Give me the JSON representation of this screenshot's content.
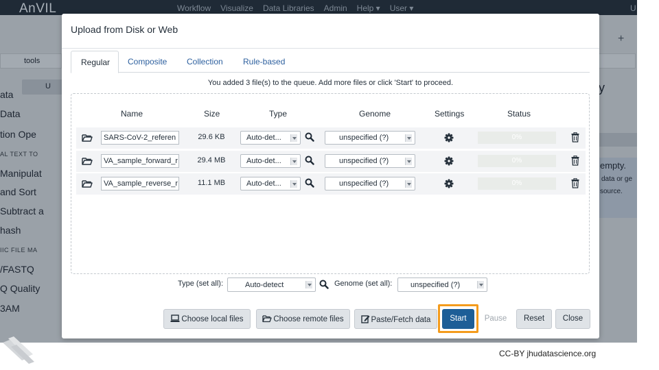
{
  "app": {
    "brand": "AnVIL",
    "nav": [
      "Workflow",
      "Visualize",
      "Data Libraries",
      "Admin",
      "Help ▾",
      "User ▾"
    ],
    "user_initial": "U",
    "right_panel": {
      "plus": "+",
      "partial_title": "y",
      "empty_text": "empty.",
      "line1": "data or ge",
      "line2": "source."
    },
    "left_panel": {
      "search": "tools",
      "upload": "U",
      "items": [
        {
          "kind": "tool",
          "label": "ata"
        },
        {
          "kind": "tool",
          "label": "Data"
        },
        {
          "kind": "tool",
          "label": "tion Ope"
        },
        {
          "kind": "section",
          "label": "AL TEXT TO"
        },
        {
          "kind": "tool",
          "label": "Manipulat"
        },
        {
          "kind": "tool",
          "label": "and Sort"
        },
        {
          "kind": "tool",
          "label": "Subtract a"
        },
        {
          "kind": "tool",
          "label": "hash"
        },
        {
          "kind": "section",
          "label": "IIC FILE MA"
        },
        {
          "kind": "tool",
          "label": "/FASTQ"
        },
        {
          "kind": "tool",
          "label": "Q Quality"
        },
        {
          "kind": "tool",
          "label": "3AM"
        }
      ]
    }
  },
  "modal": {
    "title": "Upload from Disk or Web",
    "tabs": [
      "Regular",
      "Composite",
      "Collection",
      "Rule-based"
    ],
    "active_tab": "Regular",
    "queue_message": "You added 3 file(s) to the queue. Add more files or click 'Start' to proceed.",
    "columns": [
      "Name",
      "Size",
      "Type",
      "Genome",
      "Settings",
      "Status"
    ],
    "rows": [
      {
        "name": "SARS-CoV-2_referen",
        "size": "29.6 KB",
        "type": "Auto-det...",
        "genome": "unspecified (?)",
        "status": "0%",
        "progress": 0
      },
      {
        "name": "VA_sample_forward_r",
        "size": "29.4 MB",
        "type": "Auto-det...",
        "genome": "unspecified (?)",
        "status": "0%",
        "progress": 0
      },
      {
        "name": "VA_sample_reverse_r",
        "size": "11.1 MB",
        "type": "Auto-det...",
        "genome": "unspecified (?)",
        "status": "0%",
        "progress": 0
      }
    ],
    "set_all": {
      "type_label": "Type (set all):",
      "type_value": "Auto-detect",
      "genome_label": "Genome (set all):",
      "genome_value": "unspecified (?)"
    },
    "buttons": {
      "choose_local": "Choose local files",
      "choose_remote": "Choose remote files",
      "paste_fetch": "Paste/Fetch data",
      "start": "Start",
      "pause": "Pause",
      "reset": "Reset",
      "close": "Close"
    },
    "highlight_color": "#f49b1c",
    "start_color": "#1d5e97"
  },
  "footer": {
    "credit": "CC-BY  jhudatascience.org"
  }
}
